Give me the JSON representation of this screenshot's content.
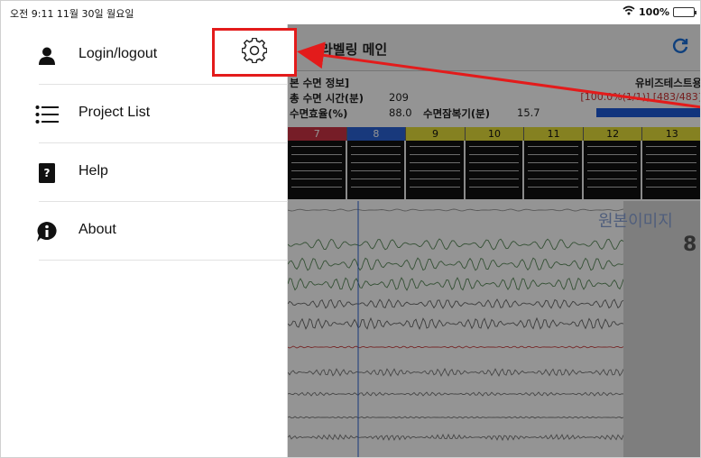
{
  "status_bar": {
    "time_date": "오전 9:11   11월 30일 월요일",
    "battery": "100%"
  },
  "drawer": {
    "items": [
      {
        "label": "Login/logout",
        "icon": "person-icon"
      },
      {
        "label": "Project List",
        "icon": "list-icon"
      },
      {
        "label": "Help",
        "icon": "help-book-icon"
      },
      {
        "label": "About",
        "icon": "info-icon"
      }
    ],
    "settings_icon": "gear-icon"
  },
  "main": {
    "title": "라벨링 메인",
    "info_title": "본 수면 정보]",
    "total_sleep_label": "총 수면 시간(분)",
    "total_sleep_value": "209",
    "efficiency_label": "수면효율(%)",
    "efficiency_value": "88.0",
    "latency_label": "수면잠복기(분)",
    "latency_value": "15.7",
    "project_name": "유비즈테스트용",
    "progress_text": "[100.0%(1/1)] [483/483]",
    "epochs": [
      "7",
      "8",
      "9",
      "10",
      "11",
      "12",
      "13"
    ],
    "epoch_colors": [
      "#cc3344",
      "#2a62d6",
      "#e6df3a",
      "#e6df3a",
      "#e6df3a",
      "#e6df3a",
      "#e6df3a"
    ],
    "side_text": "원본이미지",
    "side_number": "8"
  },
  "colors": {
    "highlight": "#e31b1b",
    "accent": "#1a6fd8"
  }
}
